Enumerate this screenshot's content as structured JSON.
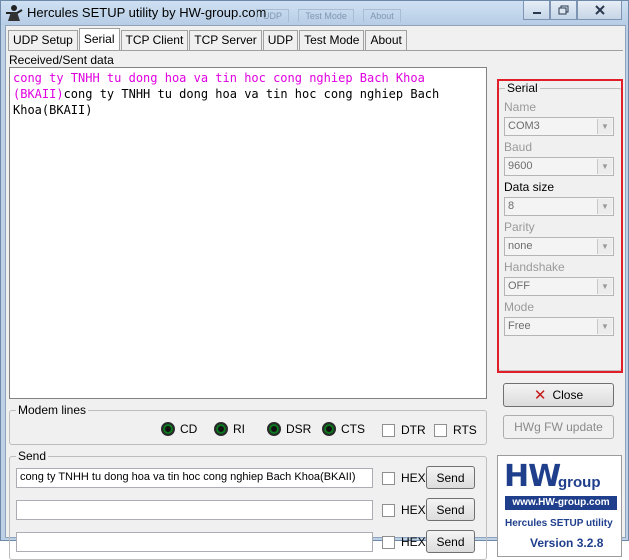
{
  "window": {
    "title": "Hercules SETUP utility by HW-group.com",
    "ghost_tabs": [
      "UDP",
      "Test Mode",
      "About"
    ]
  },
  "tabs": [
    "UDP Setup",
    "Serial",
    "TCP Client",
    "TCP Server",
    "UDP",
    "Test Mode",
    "About"
  ],
  "active_tab": "Serial",
  "received": {
    "label": "Received/Sent data",
    "sent_text": "cong ty TNHH tu dong hoa va tin hoc cong nghiep Bach Khoa (BKAII)",
    "received_text": "cong ty TNHH tu dong hoa va tin hoc cong nghiep Bach Khoa(BKAII)"
  },
  "modem": {
    "legend": "Modem lines",
    "leds": [
      "CD",
      "RI",
      "DSR",
      "CTS"
    ],
    "checks": [
      "DTR",
      "RTS"
    ]
  },
  "send": {
    "legend": "Send",
    "rows": [
      {
        "value": "cong ty TNHH tu dong hoa va tin hoc cong nghiep Bach Khoa(BKAII)",
        "hex_label": "HEX",
        "button": "Send"
      },
      {
        "value": "",
        "hex_label": "HEX",
        "button": "Send"
      },
      {
        "value": "",
        "hex_label": "HEX",
        "button": "Send"
      }
    ]
  },
  "serial": {
    "legend": "Serial",
    "fields": [
      {
        "label": "Name",
        "value": "COM3",
        "enabled": false
      },
      {
        "label": "Baud",
        "value": "9600",
        "enabled": false
      },
      {
        "label": "Data size",
        "value": "8",
        "enabled": true
      },
      {
        "label": "Parity",
        "value": "none",
        "enabled": false
      },
      {
        "label": "Handshake",
        "value": "OFF",
        "enabled": false
      },
      {
        "label": "Mode",
        "value": "Free",
        "enabled": false
      }
    ],
    "highlight_color": "#e11d2a"
  },
  "buttons": {
    "close": "Close",
    "fw_update": "HWg FW update"
  },
  "logo": {
    "brand": "HW",
    "group": "group",
    "url": "www.HW-group.com",
    "app": "Hercules SETUP utility",
    "version": "Version  3.2.8"
  }
}
